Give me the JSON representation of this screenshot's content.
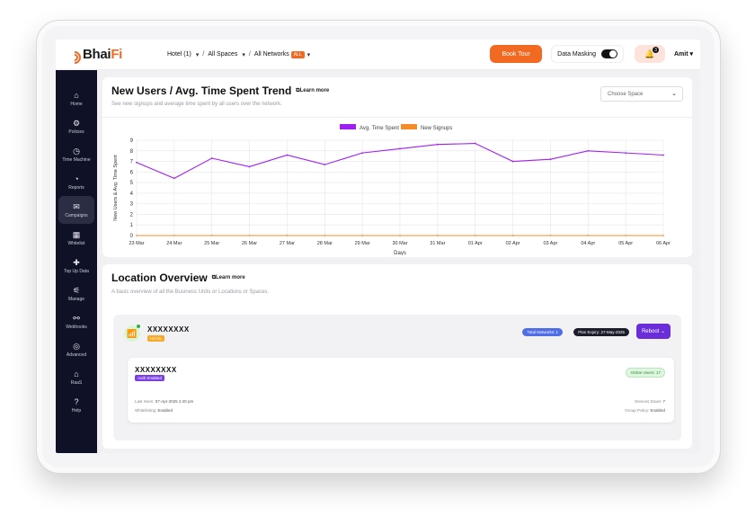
{
  "brand": {
    "logo_pre": "Bhai",
    "logo_post": "Fi"
  },
  "topbar": {
    "crumbs": [
      {
        "label": "Hotel (1)"
      },
      {
        "label": "All Spaces"
      },
      {
        "label": "All Networks",
        "tag": "ALL"
      }
    ],
    "book_tour": "Book Tour",
    "data_masking": "Data Masking",
    "notif_count": "3",
    "user": "Amit"
  },
  "sidebar": {
    "items": [
      {
        "label": "Home",
        "icon": "home-icon"
      },
      {
        "label": "Policies",
        "icon": "policies-icon"
      },
      {
        "label": "Time Machine",
        "icon": "clock-icon"
      },
      {
        "label": "Reports",
        "icon": "reports-icon"
      },
      {
        "label": "Campaigns",
        "icon": "campaigns-icon"
      },
      {
        "label": "Whitelist",
        "icon": "whitelist-icon"
      },
      {
        "label": "Top Up Data",
        "icon": "plus-icon"
      },
      {
        "label": "Manage",
        "icon": "manage-icon"
      },
      {
        "label": "Webhooks",
        "icon": "webhooks-icon"
      },
      {
        "label": "Advanced",
        "icon": "advanced-icon"
      },
      {
        "label": "RaaS",
        "icon": "raas-icon"
      },
      {
        "label": "Help",
        "icon": "help-icon"
      }
    ],
    "active_index": 4
  },
  "trend": {
    "title": "New Users / Avg. Time Spent Trend",
    "learn_more": "Learn more",
    "subtitle": "See new signups and average time spent by all users over the network.",
    "select_placeholder": "Choose Space"
  },
  "chart_data": {
    "type": "line",
    "x": [
      "23 Mar",
      "24 Mar",
      "25 Mar",
      "26 Mar",
      "27 Mar",
      "28 Mar",
      "29 Mar",
      "30 Mar",
      "31 Mar",
      "01 Apr",
      "02 Apr",
      "03 Apr",
      "04 Apr",
      "05 Apr",
      "06 Apr"
    ],
    "series": [
      {
        "name": "Avg. Time Spent",
        "color": "#a020f0",
        "values": [
          6.9,
          5.4,
          7.3,
          6.5,
          7.6,
          6.7,
          7.8,
          8.2,
          8.6,
          8.7,
          7.0,
          7.2,
          8.0,
          7.8,
          7.6
        ]
      },
      {
        "name": "New Signups",
        "color": "#f58c2a",
        "values": [
          0,
          0,
          0,
          0,
          0,
          0,
          0,
          0,
          0,
          0,
          0,
          0,
          0,
          0,
          0
        ]
      }
    ],
    "xlabel": "Days",
    "ylabel": "New Users & Avg. Time Spent",
    "ylim": [
      0,
      9
    ],
    "yticks": [
      0,
      1,
      2,
      3,
      4,
      5,
      6,
      7,
      8,
      9
    ],
    "grid": true,
    "legend": "top-center"
  },
  "location": {
    "title": "Location Overview",
    "learn_more": "Learn more",
    "subtitle": "A basic overview of all the Business Units or Locations or Spaces.",
    "name": "XXXXXXXX",
    "badge": "HOTEL",
    "total_networks": "Total Networks: 1",
    "plan_expiry": "Plan Expiry: 27-May-2025",
    "reboot": "Reboot",
    "network": {
      "name": "XXXXXXXX",
      "auth": "Auth Enabled",
      "online_users": "Online Users: 17",
      "last_seen_k": "Last Seen:",
      "last_seen_v": "07-Apr-2025 2:40 pm",
      "whitelisting_k": "Whitelisting:",
      "whitelisting_v": "Enabled",
      "devices_k": "Devices Down:",
      "devices_v": "7",
      "group_k": "Group Policy:",
      "group_v": "Enabled"
    }
  }
}
